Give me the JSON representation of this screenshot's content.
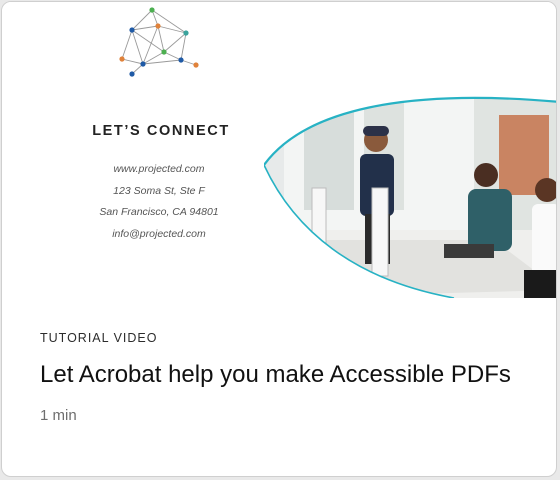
{
  "thumbnail": {
    "heading": "LET’S CONNECT",
    "contact_lines": [
      "www.projected.com",
      "123 Soma St, Ste F",
      "San Francisco, CA 94801",
      "info@projected.com"
    ],
    "accent_color": "#27b2c4"
  },
  "card": {
    "eyebrow": "TUTORIAL VIDEO",
    "title": "Let Acrobat help you make Accessible PDFs",
    "duration": "1 min"
  }
}
